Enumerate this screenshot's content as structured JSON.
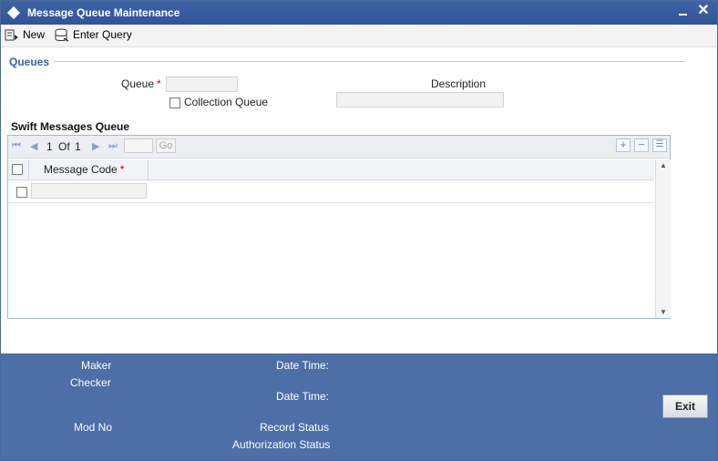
{
  "window": {
    "title": "Message Queue Maintenance",
    "minimize_label": "minimize",
    "close_glyph": "✕"
  },
  "toolbar": {
    "new_label": "New",
    "enter_query_label": "Enter Query"
  },
  "queues": {
    "section_label": "Queues",
    "queue_label": "Queue",
    "queue_value": "",
    "required_mark": "*",
    "collection_queue_label": "Collection Queue",
    "collection_queue_checked": false,
    "description_label": "Description",
    "description_value": ""
  },
  "swift": {
    "section_label": "Swift Messages Queue",
    "pager": {
      "current": "1",
      "of_label": "Of",
      "total": "1",
      "go_label": "Go"
    },
    "columns": [
      {
        "label": "Message Code",
        "required": "*"
      }
    ],
    "rows": [
      {
        "message_code": ""
      }
    ]
  },
  "footer": {
    "maker_label": "Maker",
    "checker_label": "Checker",
    "date_time_label_1": "Date Time:",
    "date_time_label_2": "Date Time:",
    "mod_no_label": "Mod No",
    "record_status_label": "Record Status",
    "authorization_status_label": "Authorization Status",
    "exit_label": "Exit"
  },
  "colors": {
    "titlebar": "#2f5497",
    "footer": "#4d6ea6",
    "section": "#3d5f9c",
    "required": "#cc0000"
  }
}
